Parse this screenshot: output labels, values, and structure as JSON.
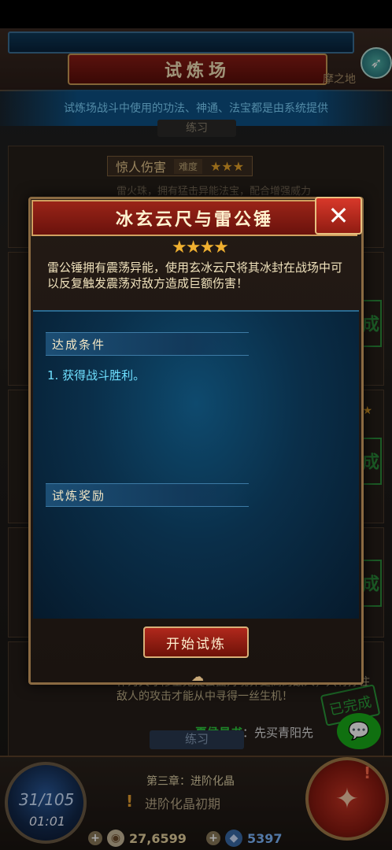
{
  "header": {
    "title": "试炼场",
    "side_tag": "摩之地",
    "info_text": "试炼场战斗中使用的功法、神通、法宝都是由系统提供",
    "tab_label": "练习"
  },
  "background_cards": {
    "first_card": {
      "name": "惊人伤害",
      "difficulty_label": "难度",
      "stars": "★★★",
      "snippet": "雷火珠，拥有猛击异能法宝，配合增强威力"
    },
    "done_mark": "成",
    "right_stars": "★★",
    "bottom_description": "作为天才修士无疑会面对境界更高的敌人，只有撑住敌人的攻击才能从中寻得一丝生机！",
    "big_stamp": "已完成",
    "bottom_tab_label": "练习"
  },
  "promo": {
    "highlight": "夏侯易书",
    "text": "：先买青阳先"
  },
  "dialog": {
    "title": "冰玄云尺与雷公锤",
    "stars": "★★★★",
    "description": "雷公锤拥有震荡异能，使用玄冰云尺将其冰封在战场中可以反复触发震荡对敌方造成巨额伤害！",
    "section_conditions": "达成条件",
    "condition_1": "1. 获得战斗胜利。",
    "section_rewards": "试炼奖励",
    "start_button": "开始试炼",
    "close_icon": "✕"
  },
  "bottom_bar": {
    "orb_count": "31/105",
    "orb_time": "01:01",
    "chapter": "第三章：进阶化晶",
    "quest": "进阶化晶初期",
    "gold_amount": "27,6599",
    "gem_amount": "5397"
  },
  "icons": {
    "launch": "rocket-icon",
    "wechat": "wechat-icon",
    "quest": "exclamation-icon",
    "gold": "coin-icon",
    "gem": "gem-icon",
    "action": "compass-icon"
  },
  "colors": {
    "accent_red": "#9a2418",
    "panel_blue": "#0e4a6e",
    "gold_star": "#f0b030",
    "condition_cyan": "#6fe0ff"
  }
}
